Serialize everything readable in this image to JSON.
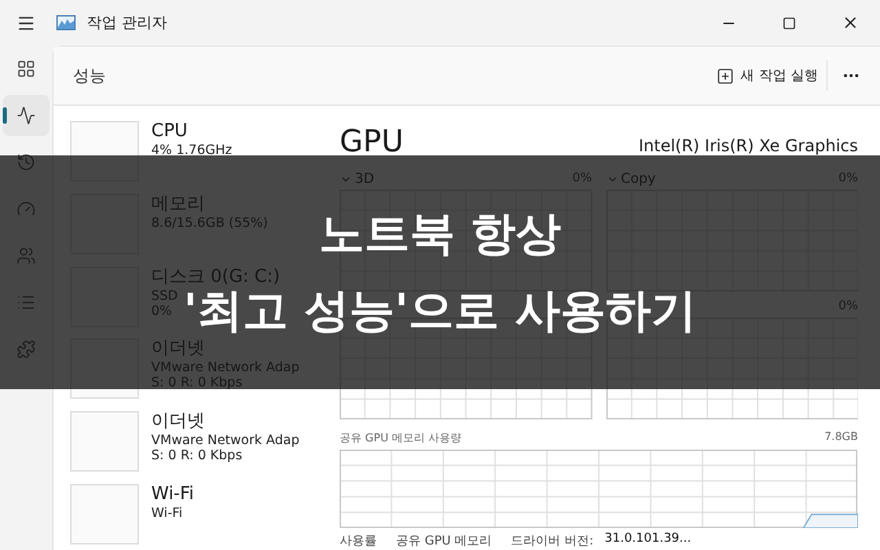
{
  "window": {
    "title": "작업 관리자"
  },
  "nav": [
    {
      "selected": false
    },
    {
      "selected": true
    },
    {
      "selected": false
    },
    {
      "selected": false
    },
    {
      "selected": false
    },
    {
      "selected": false
    },
    {
      "selected": false
    }
  ],
  "header": {
    "title": "성능",
    "run_task": "새 작업 실행"
  },
  "devices": [
    {
      "name": "CPU",
      "lines": [
        "4% 1.76GHz"
      ]
    },
    {
      "name": "메모리",
      "lines": [
        "8.6/15.6GB (55%)"
      ]
    },
    {
      "name": "디스크 0(G: C:)",
      "lines": [
        "SSD",
        "0%"
      ]
    },
    {
      "name": "이더넷",
      "lines": [
        "VMware Network Adap",
        "S: 0  R: 0 Kbps"
      ]
    },
    {
      "name": "이더넷",
      "lines": [
        "VMware Network Adap",
        "S: 0  R: 0 Kbps"
      ]
    },
    {
      "name": "Wi-Fi",
      "lines": [
        "Wi-Fi"
      ]
    }
  ],
  "gpu": {
    "title": "GPU",
    "model": "Intel(R) Iris(R) Xe Graphics",
    "engines": [
      {
        "kind": "labeled",
        "name": "3D",
        "value": "0%"
      },
      {
        "kind": "labeled",
        "name": "Copy",
        "value": "0%"
      },
      {
        "kind": "graph"
      },
      {
        "kind": "graph",
        "value": "0%"
      }
    ],
    "shared_memory": {
      "label": "공유 GPU 메모리 사용량",
      "max": "7.8GB"
    },
    "stats": [
      {
        "label": "사용률"
      },
      {
        "label": "공유 GPU 메모리"
      },
      {
        "label": "드라이버 버전:",
        "value": "31.0.101.39..."
      }
    ]
  },
  "banner": {
    "lines": [
      "노트북 항상",
      "'최고 성능'으로 사용하기"
    ]
  }
}
